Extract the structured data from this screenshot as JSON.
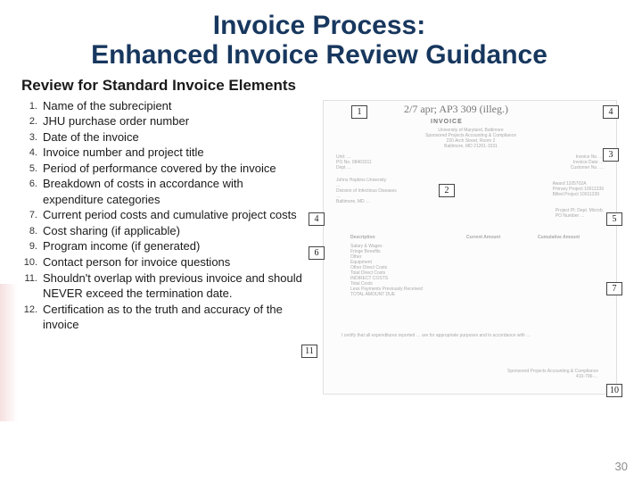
{
  "title": "Invoice Process:\nEnhanced Invoice Review Guidance",
  "subtitle": "Review for Standard Invoice Elements",
  "items": [
    "Name of the subrecipient",
    "JHU purchase order number",
    "Date of the invoice",
    "Invoice number and project title",
    "Period of performance covered by the invoice",
    "Breakdown of costs in accordance with expenditure categories",
    "Current period costs and cumulative project costs",
    "Cost sharing (if applicable)",
    "Program income (if generated)",
    "Contact person for invoice questions",
    "Shouldn't overlap with previous invoice and should NEVER exceed the termination date.",
    "Certification as to the truth and accuracy of the invoice"
  ],
  "callouts": {
    "c1": "1",
    "c2": "2",
    "c3": "3",
    "c4a": "4",
    "c4b": "4",
    "c5": "5",
    "c6": "6",
    "c7": "7",
    "c10": "10",
    "c11": "11"
  },
  "invoice_stub": {
    "scribble": "2/7 apr; AP3 309 (illeg.)",
    "header": "INVOICE",
    "addr": "University of Maryland, Baltimore\nSponsored Projects Accounting & Compliance\n220 Arch Street, Room 2\nBaltimore, MD 21201-1531",
    "left1": "Unit: …\nPO No. 08463311\nDept …",
    "left2": "Johns Hopkins University\n…\nDivision of Infectious Diseases\n…\nBaltimore, MD …",
    "right1": "Invoice No. …\nInvoice Date …\nCustomer No. …",
    "right2": "Award          1105702A\nPrimary Project 10011339\nBilled Project  10011339",
    "right3": "Project PI: Dept. Microb.\nPO Number …",
    "tbl_desc": "Description",
    "tbl_cur": "Current Amount",
    "tbl_cum": "Cumulative Amount",
    "rows": "Salary & Wages\nFringe Benefits\nOther\nEquipment\nOther Direct Costs\nTotal Direct Costs\nINDIRECT COSTS\nTotal Costs\nLess Payments Previously Received\nTOTAL AMOUNT DUE",
    "cert": "I certify that all expenditures reported … are for appropriate purposes and in accordance with …",
    "sig": "Sponsored Projects Accounting & Compliance\n410-706-…"
  },
  "page_number": "30"
}
